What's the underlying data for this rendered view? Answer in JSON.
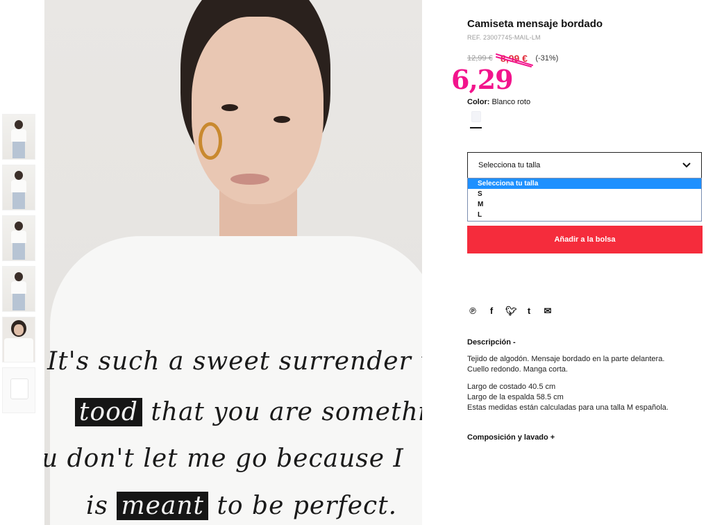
{
  "product": {
    "title": "Camiseta mensaje bordado",
    "ref": "REF. 23007745-MAIL-LM",
    "old_price": "12,99 €",
    "sale_price": "8,99 €",
    "discount": "(-31%)",
    "handwritten_price": "6,29"
  },
  "color": {
    "label": "Color:",
    "value": "Blanco roto",
    "swatch_color": "#f3f4f8"
  },
  "size_select": {
    "label": "Selecciona tu talla",
    "options": [
      "Selecciona tu talla",
      "S",
      "M",
      "L"
    ],
    "selected_index": 0
  },
  "add_to_bag": "Añadir a la bolsa",
  "social_icons": [
    "pinterest-icon",
    "facebook-icon",
    "twitter-icon",
    "tumblr-icon",
    "email-icon"
  ],
  "description": {
    "heading": "Descripción -",
    "p1_line1": "Tejido de algodón. Mensaje bordado en la parte delantera.",
    "p1_line2": "Cuello redondo. Manga corta.",
    "p2_line1": "Largo de costado 40.5 cm",
    "p2_line2": "Largo de la espalda 58.5 cm",
    "p2_line3": "Estas medidas están calculadas para una talla M española."
  },
  "composition_heading": "Composición y lavado +",
  "shirt_print": {
    "line1": "It's such a sweet surrender when",
    "line2a": "tood",
    "line2b": "that you are something",
    "line3": "u don't let me go because I",
    "line4a": "is",
    "line4b": "meant",
    "line4c": "to be perfect."
  },
  "colors": {
    "accent_red": "#f52c3c",
    "sale_red": "#e2313f",
    "handwriting_pink": "#f2148c",
    "dropdown_highlight": "#1e90ff"
  }
}
